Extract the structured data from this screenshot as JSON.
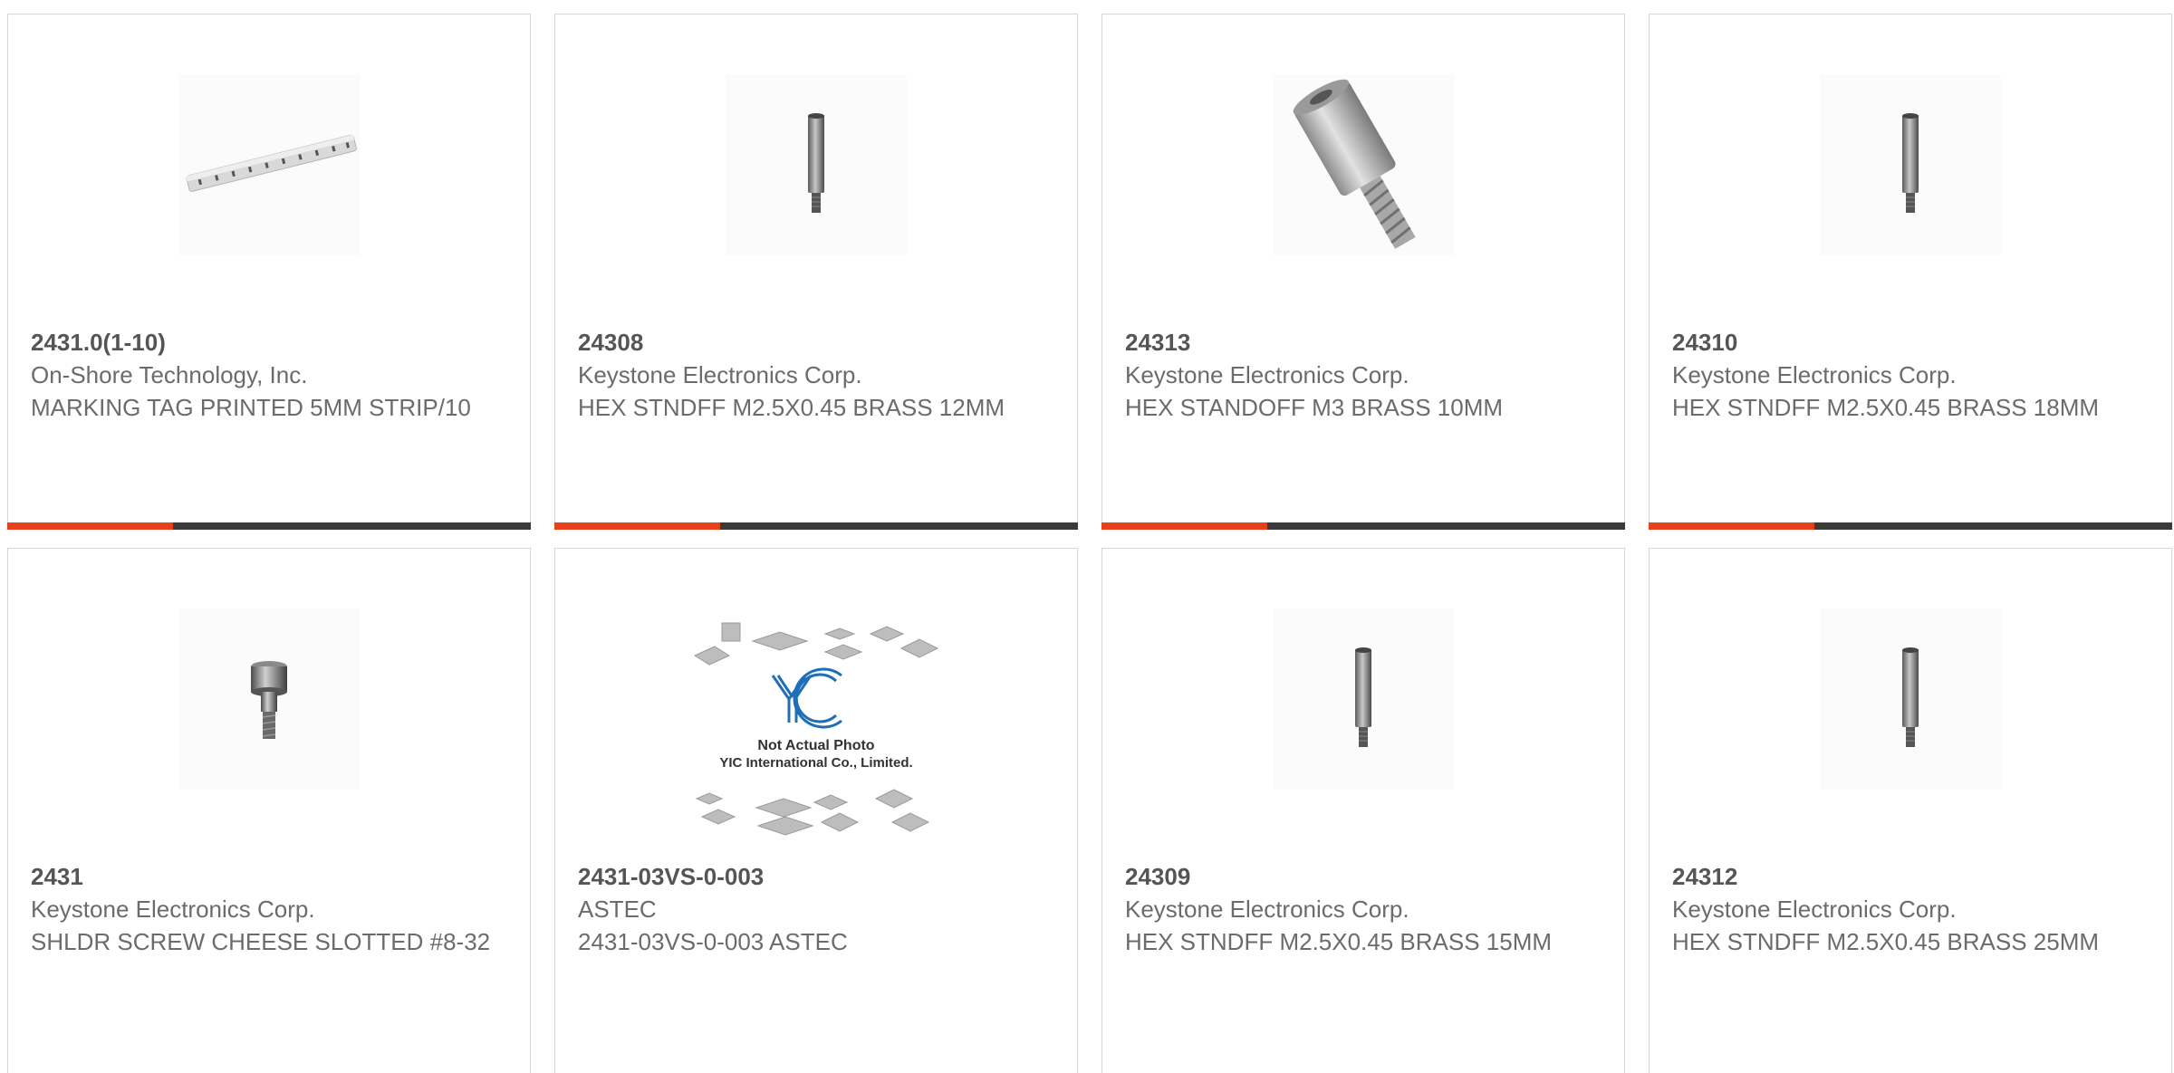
{
  "products": [
    {
      "part": "2431.0(1-10)",
      "maker": "On-Shore Technology, Inc.",
      "desc": "MARKING TAG PRINTED 5MM STRIP/10",
      "image": "marking-tag-strip"
    },
    {
      "part": "24308",
      "maker": "Keystone Electronics Corp.",
      "desc": "HEX STNDFF M2.5X0.45 BRASS 12MM",
      "image": "hex-standoff"
    },
    {
      "part": "24313",
      "maker": "Keystone Electronics Corp.",
      "desc": "HEX STANDOFF M3 BRASS 10MM",
      "image": "hex-standoff-large"
    },
    {
      "part": "24310",
      "maker": "Keystone Electronics Corp.",
      "desc": "HEX STNDFF M2.5X0.45 BRASS 18MM",
      "image": "hex-standoff"
    },
    {
      "part": "2431",
      "maker": "Keystone Electronics Corp.",
      "desc": "SHLDR SCREW CHEESE SLOTTED #8-32",
      "image": "shoulder-screw"
    },
    {
      "part": "2431-03VS-0-003",
      "maker": "ASTEC",
      "desc": "2431-03VS-0-003 ASTEC",
      "image": "not-actual-photo",
      "placeholder_line1": "Not Actual Photo",
      "placeholder_line2": "YIC International Co., Limited.",
      "placeholder_logo": "YIC"
    },
    {
      "part": "24309",
      "maker": "Keystone Electronics Corp.",
      "desc": "HEX STNDFF M2.5X0.45 BRASS 15MM",
      "image": "hex-standoff"
    },
    {
      "part": "24312",
      "maker": "Keystone Electronics Corp.",
      "desc": "HEX STNDFF M2.5X0.45 BRASS 25MM",
      "image": "hex-standoff"
    }
  ],
  "colors": {
    "accent": "#e5411b",
    "bar": "#3a3a3a",
    "border": "#d6d6d6",
    "text": "#6b6b6b",
    "part_text": "#555555"
  }
}
